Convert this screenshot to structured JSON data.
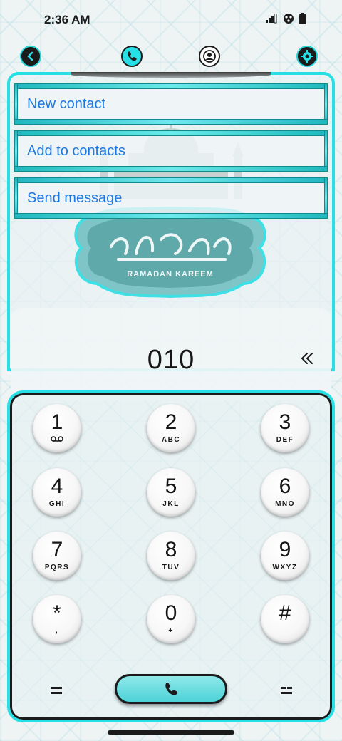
{
  "status_bar": {
    "time": "2:36 AM",
    "icons": [
      "signal-icon",
      "sync-icon",
      "battery-icon"
    ]
  },
  "top_nav": {
    "items": [
      {
        "name": "back-icon"
      },
      {
        "name": "phone-icon"
      },
      {
        "name": "contact-icon"
      },
      {
        "name": "settings-icon"
      }
    ]
  },
  "menu": {
    "items": [
      {
        "label": "New contact"
      },
      {
        "label": "Add to contacts"
      },
      {
        "label": "Send message"
      }
    ]
  },
  "banner": {
    "caption": "RAMADAN KAREEM"
  },
  "dialer": {
    "number": "010"
  },
  "keypad": {
    "keys": [
      {
        "digit": "1",
        "sub": ""
      },
      {
        "digit": "2",
        "sub": "ABC"
      },
      {
        "digit": "3",
        "sub": "DEF"
      },
      {
        "digit": "4",
        "sub": "GHI"
      },
      {
        "digit": "5",
        "sub": "JKL"
      },
      {
        "digit": "6",
        "sub": "MNO"
      },
      {
        "digit": "7",
        "sub": "PQRS"
      },
      {
        "digit": "8",
        "sub": "TUV"
      },
      {
        "digit": "9",
        "sub": "WXYZ"
      },
      {
        "digit": "*",
        "sub": ","
      },
      {
        "digit": "0",
        "sub": "+"
      },
      {
        "digit": "#",
        "sub": ""
      }
    ]
  },
  "colors": {
    "accent": "#27e0e6",
    "link": "#1c77e0",
    "dark": "#1b1b1b"
  }
}
